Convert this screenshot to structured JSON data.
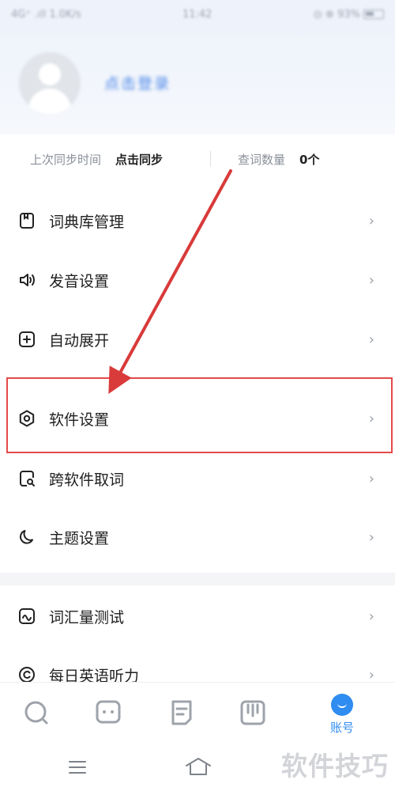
{
  "status_bar": {
    "left": "4G⁺ .ıll 1.0K/s",
    "time": "11:42",
    "right": "◎ ⊗ 93%"
  },
  "profile": {
    "login_text": "点击登录"
  },
  "sync": {
    "last_sync_label": "上次同步时间",
    "last_sync_action": "点击同步",
    "lookup_count_label": "查词数量",
    "lookup_count_value": "0个"
  },
  "menu": {
    "items": [
      {
        "label": "词典库管理",
        "icon": "dictionary-icon"
      },
      {
        "label": "发音设置",
        "icon": "speaker-icon"
      },
      {
        "label": "自动展开",
        "icon": "expand-plus-icon"
      },
      {
        "label": "软件设置",
        "icon": "hexagon-settings-icon"
      },
      {
        "label": "跨软件取词",
        "icon": "cross-app-search-icon"
      },
      {
        "label": "主题设置",
        "icon": "moon-icon"
      }
    ],
    "items2": [
      {
        "label": "词汇量测试",
        "icon": "vocab-test-icon"
      },
      {
        "label": "每日英语听力",
        "icon": "listening-icon"
      }
    ],
    "chevron": "›"
  },
  "tab_bar": {
    "tabs": [
      {
        "icon": "search-tab-icon"
      },
      {
        "icon": "chat-tab-icon"
      },
      {
        "icon": "notes-tab-icon"
      },
      {
        "icon": "book-tab-icon"
      }
    ],
    "active_label": "账号"
  },
  "watermark": "软件技巧",
  "colors": {
    "accent": "#2f8cf0",
    "highlight_border": "#e54a4a",
    "arrow": "#d93a3a"
  }
}
